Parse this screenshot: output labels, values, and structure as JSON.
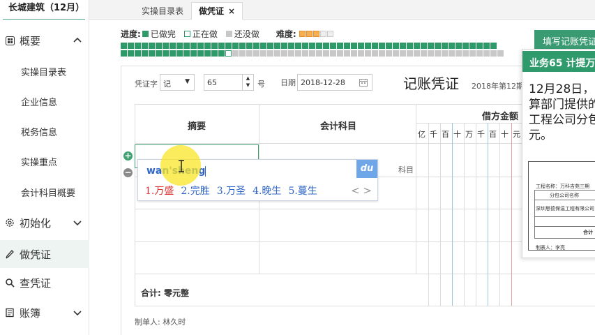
{
  "sidebar": {
    "company": "长城建筑（12月）",
    "groups": [
      {
        "label": "概要",
        "icon": "grid-icon",
        "chevron": "up"
      },
      {
        "label": "初始化",
        "icon": "gear-icon",
        "chevron": "down"
      },
      {
        "label": "做凭证",
        "icon": "pen-icon",
        "chevron": ""
      },
      {
        "label": "查凭证",
        "icon": "search-icon",
        "chevron": ""
      },
      {
        "label": "账簿",
        "icon": "book-icon",
        "chevron": "down"
      }
    ],
    "sub_items": [
      "实操目录表",
      "企业信息",
      "税务信息",
      "实操重点",
      "会计科目概要"
    ]
  },
  "tabs": [
    {
      "label": "实操目录表",
      "active": false
    },
    {
      "label": "做凭证",
      "active": true,
      "close": "×"
    }
  ],
  "progress": {
    "label": "进度:",
    "legend": [
      {
        "label": "已做完",
        "state": "done"
      },
      {
        "label": "正在做",
        "state": "doing"
      },
      {
        "label": "还没做",
        "state": "todo"
      }
    ],
    "difficulty_label": "难度:",
    "difficulty": {
      "value": 3,
      "max": 5
    },
    "cells_row1_done": 54,
    "cells_row2": {
      "done": 15,
      "current_index": 15,
      "todo_after": 39
    }
  },
  "voucher": {
    "type_label": "凭证字",
    "type_value": "记",
    "number_value": "65",
    "number_suffix": "号",
    "date_label": "日期",
    "date_value": "2018-12-28",
    "title": "记账凭证",
    "period": "2018年第12期",
    "headers": {
      "summary": "摘要",
      "account": "会计科目",
      "debit": "借方金额"
    },
    "digits": [
      "亿",
      "千",
      "百",
      "十",
      "万",
      "千",
      "百",
      "十",
      "元"
    ],
    "subject_hint": "科目",
    "total_label": "合计: 零元整",
    "maker_label": "制单人: 林久时"
  },
  "ime": {
    "input": "wan'sheng",
    "logo": "du",
    "candidates": [
      "1.万盛",
      "2.完胜",
      "3.万圣",
      "4.晚生",
      "5.蔓生"
    ],
    "nav": "< >"
  },
  "task": {
    "button": "填写记账凭证",
    "header": "业务65 计提万",
    "body_lines": [
      "12月28日，",
      "算部门提供的",
      "工程公司分包",
      "元。"
    ],
    "doc": {
      "line1": "工程名称：万科吉苑三期",
      "col_header": "分包公司名称",
      "row1": "深圳思德保温工程有限公司",
      "total": "合计",
      "footer": "制表人：李亮"
    }
  },
  "colors": {
    "accent": "#3a9b72",
    "ime_blue": "#2f66c6",
    "todo": "#c8c8c8",
    "highlight": "#fae628"
  }
}
